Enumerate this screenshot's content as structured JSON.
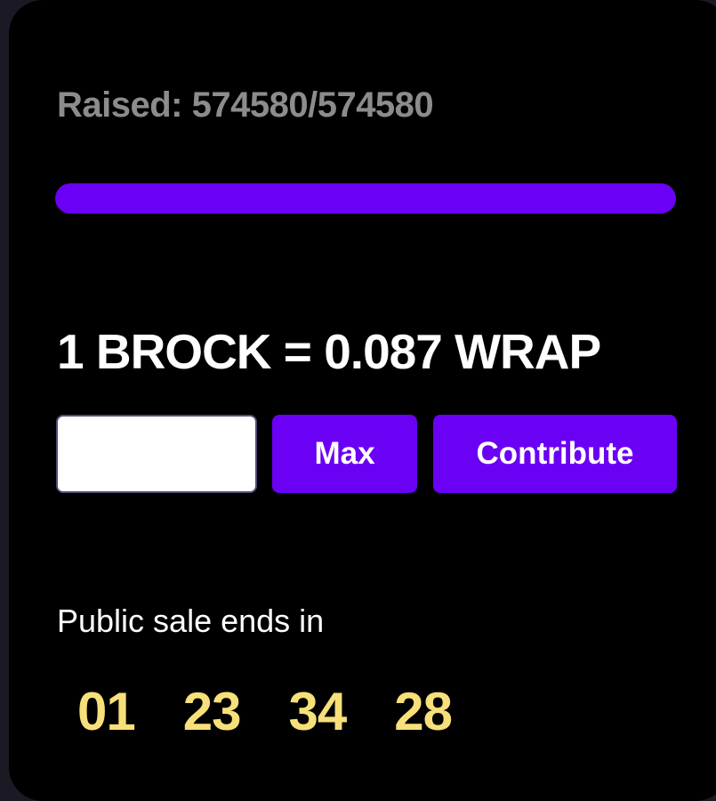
{
  "raised": {
    "label": "Raised: 574580/574580",
    "progress_fraction": 1.0
  },
  "colors": {
    "accent": "#6a00f4",
    "countdown": "#f7e07a",
    "muted_text": "#8c8c8c",
    "card_background": "#000000"
  },
  "rate": {
    "text": "1 BROCK = 0.087 WRAP"
  },
  "contribution": {
    "input_value": "",
    "max_label": "Max",
    "contribute_label": "Contribute"
  },
  "sale": {
    "label": "Public sale ends in",
    "countdown": [
      "01",
      "23",
      "34",
      "28"
    ]
  }
}
